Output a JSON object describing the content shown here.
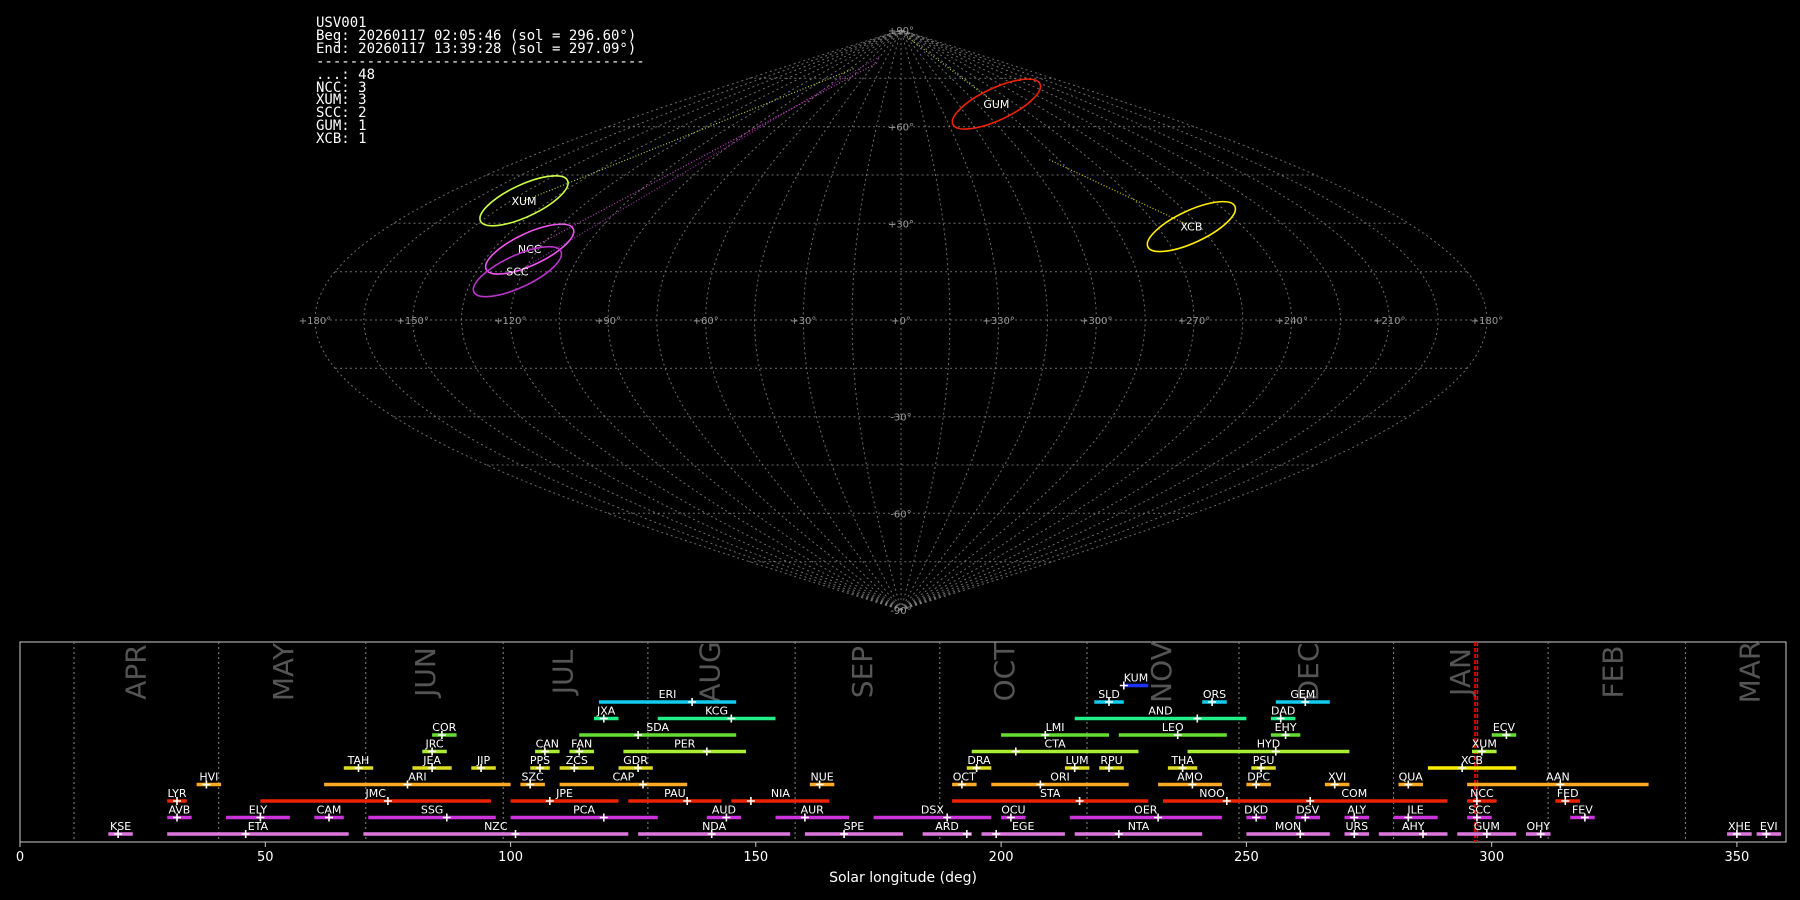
{
  "info": {
    "title": "USV001",
    "beg": "Beg: 20260117 02:05:46 (sol = 296.60°)",
    "end": "End: 20260117 13:39:28 (sol = 297.09°)",
    "divider": "---------------------------------------",
    "counts": [
      {
        "label": "...: 48"
      },
      {
        "label": "NCC: 3"
      },
      {
        "label": "XUM: 3"
      },
      {
        "label": "SCC: 2"
      },
      {
        "label": "GUM: 1"
      },
      {
        "label": "XCB: 1"
      }
    ]
  },
  "sky_map": {
    "type": "scatter",
    "projection": "sinusoidal",
    "lon_ticks": [
      "+180°",
      "+150°",
      "+120°",
      "+90°",
      "+60°",
      "+30°",
      "+0°",
      "+330°",
      "+300°",
      "+270°",
      "+240°",
      "+210°",
      "+180°"
    ],
    "lat_ticks": [
      {
        "lat": 90,
        "label": "+90°"
      },
      {
        "lat": 60,
        "label": "+60°"
      },
      {
        "lat": 30,
        "label": "+30°"
      },
      {
        "lat": -30,
        "label": "-30°"
      },
      {
        "lat": -60,
        "label": "-60°"
      },
      {
        "lat": -90,
        "label": "-90°"
      }
    ],
    "radiants": [
      {
        "name": "XUM",
        "lon": 145,
        "lat": 37,
        "color": "#ccff44"
      },
      {
        "name": "NCC",
        "lon": 123,
        "lat": 22,
        "color": "#ee55ee"
      },
      {
        "name": "SCC",
        "lon": 122,
        "lat": 15,
        "color": "#bb33cc"
      },
      {
        "name": "GUM",
        "lon": 285,
        "lat": 67,
        "color": "#ee2200"
      },
      {
        "name": "XCB",
        "lon": 258,
        "lat": 29,
        "color": "#ffee00"
      }
    ]
  },
  "timeline": {
    "type": "bar",
    "xlabel": "Solar longitude (deg)",
    "xlim": [
      0,
      360
    ],
    "xticks": [
      0,
      50,
      100,
      150,
      200,
      250,
      300,
      350
    ],
    "current_sol": [
      296.6,
      297.09
    ],
    "months": [
      {
        "name": "APR",
        "start": 11,
        "center": 24
      },
      {
        "name": "MAY",
        "start": 40.5,
        "center": 54
      },
      {
        "name": "JUN",
        "start": 70.5,
        "center": 83
      },
      {
        "name": "JUL",
        "start": 98.5,
        "center": 111
      },
      {
        "name": "AUG",
        "start": 128,
        "center": 141
      },
      {
        "name": "SEP",
        "start": 158,
        "center": 172
      },
      {
        "name": "OCT",
        "start": 187.5,
        "center": 201
      },
      {
        "name": "NOV",
        "start": 217.5,
        "center": 233
      },
      {
        "name": "DEC",
        "start": 248.5,
        "center": 263
      },
      {
        "name": "JAN",
        "start": 280,
        "center": 294
      },
      {
        "name": "FEB",
        "start": 311.5,
        "center": 325
      },
      {
        "name": "MAR",
        "start": 339.5,
        "center": 353
      }
    ],
    "showers": [
      {
        "name": "KUM",
        "row": 9,
        "start": 225,
        "end": 230,
        "peak": 225,
        "color": "#1a33ff"
      },
      {
        "name": "ERI",
        "row": 8,
        "start": 118,
        "end": 146,
        "peak": 137,
        "color": "#11ccee"
      },
      {
        "name": "SLD",
        "row": 8,
        "start": 219,
        "end": 225,
        "peak": 222,
        "color": "#11ccee"
      },
      {
        "name": "ORS",
        "row": 8,
        "start": 241,
        "end": 246,
        "peak": 243,
        "color": "#11ccee"
      },
      {
        "name": "GEM",
        "row": 8,
        "start": 256,
        "end": 267,
        "peak": 262,
        "color": "#11ccee"
      },
      {
        "name": "JXA",
        "row": 7,
        "start": 117,
        "end": 122,
        "peak": 119,
        "color": "#22ee88"
      },
      {
        "name": "KCG",
        "row": 7,
        "start": 130,
        "end": 154,
        "peak": 145,
        "color": "#22ee88"
      },
      {
        "name": "AND",
        "row": 7,
        "start": 215,
        "end": 250,
        "peak": 240,
        "color": "#22ee88"
      },
      {
        "name": "DAD",
        "row": 7,
        "start": 255,
        "end": 260,
        "peak": 257,
        "color": "#22ee88"
      },
      {
        "name": "COR",
        "row": 6,
        "start": 84,
        "end": 89,
        "peak": 86,
        "color": "#66dd33"
      },
      {
        "name": "SDA",
        "row": 6,
        "start": 114,
        "end": 146,
        "peak": 126,
        "color": "#66dd33"
      },
      {
        "name": "LMI",
        "row": 6,
        "start": 200,
        "end": 222,
        "peak": 209,
        "color": "#66dd33"
      },
      {
        "name": "LEO",
        "row": 6,
        "start": 224,
        "end": 246,
        "peak": 236,
        "color": "#66dd33"
      },
      {
        "name": "EHY",
        "row": 6,
        "start": 255,
        "end": 261,
        "peak": 258,
        "color": "#66dd33"
      },
      {
        "name": "ECV",
        "row": 6,
        "start": 300,
        "end": 305,
        "peak": 303,
        "color": "#66dd33"
      },
      {
        "name": "JRC",
        "row": 5,
        "start": 82,
        "end": 87,
        "peak": 84,
        "color": "#aaee33"
      },
      {
        "name": "CAN",
        "row": 5,
        "start": 105,
        "end": 110,
        "peak": 107,
        "color": "#aaee33"
      },
      {
        "name": "FAN",
        "row": 5,
        "start": 112,
        "end": 117,
        "peak": 114,
        "color": "#aaee33"
      },
      {
        "name": "PER",
        "row": 5,
        "start": 123,
        "end": 148,
        "peak": 140,
        "color": "#aaee33"
      },
      {
        "name": "CTA",
        "row": 5,
        "start": 194,
        "end": 228,
        "peak": 203,
        "color": "#aaee33"
      },
      {
        "name": "HYD",
        "row": 5,
        "start": 238,
        "end": 271,
        "peak": 256,
        "color": "#aaee33"
      },
      {
        "name": "XUM",
        "row": 5,
        "start": 296,
        "end": 301,
        "peak": 298,
        "color": "#aaee33"
      },
      {
        "name": "TAH",
        "row": 4,
        "start": 66,
        "end": 72,
        "peak": 69,
        "color": "#dddd22"
      },
      {
        "name": "JEA",
        "row": 4,
        "start": 80,
        "end": 88,
        "peak": 84,
        "color": "#dddd22"
      },
      {
        "name": "JIP",
        "row": 4,
        "start": 92,
        "end": 97,
        "peak": 94,
        "color": "#dddd22"
      },
      {
        "name": "PPS",
        "row": 4,
        "start": 104,
        "end": 108,
        "peak": 106,
        "color": "#dddd22"
      },
      {
        "name": "ZCS",
        "row": 4,
        "start": 110,
        "end": 117,
        "peak": 113,
        "color": "#dddd22"
      },
      {
        "name": "GDR",
        "row": 4,
        "start": 122,
        "end": 129,
        "peak": 126,
        "color": "#dddd22"
      },
      {
        "name": "DRA",
        "row": 4,
        "start": 193,
        "end": 198,
        "peak": 195,
        "color": "#dddd22"
      },
      {
        "name": "LUM",
        "row": 4,
        "start": 213,
        "end": 218,
        "peak": 215,
        "color": "#dddd22"
      },
      {
        "name": "RPU",
        "row": 4,
        "start": 220,
        "end": 225,
        "peak": 222,
        "color": "#dddd22"
      },
      {
        "name": "THA",
        "row": 4,
        "start": 234,
        "end": 240,
        "peak": 237,
        "color": "#dddd22"
      },
      {
        "name": "PSU",
        "row": 4,
        "start": 251,
        "end": 256,
        "peak": 253,
        "color": "#dddd22"
      },
      {
        "name": "XCB",
        "row": 4,
        "start": 287,
        "end": 305,
        "peak": 294,
        "color": "#ffee00"
      },
      {
        "name": "HVI",
        "row": 3,
        "start": 36,
        "end": 41,
        "peak": 38,
        "color": "#ffaa22"
      },
      {
        "name": "ARI",
        "row": 3,
        "start": 62,
        "end": 100,
        "peak": 79,
        "color": "#ffaa22"
      },
      {
        "name": "SZC",
        "row": 3,
        "start": 102,
        "end": 107,
        "peak": 104,
        "color": "#ffaa22"
      },
      {
        "name": "CAP",
        "row": 3,
        "start": 110,
        "end": 136,
        "peak": 127,
        "color": "#ffaa22"
      },
      {
        "name": "NUE",
        "row": 3,
        "start": 161,
        "end": 166,
        "peak": 163,
        "color": "#ffaa22"
      },
      {
        "name": "OCT",
        "row": 3,
        "start": 190,
        "end": 195,
        "peak": 192,
        "color": "#ffaa22"
      },
      {
        "name": "ORI",
        "row": 3,
        "start": 198,
        "end": 226,
        "peak": 208,
        "color": "#ffaa22"
      },
      {
        "name": "AMO",
        "row": 3,
        "start": 232,
        "end": 245,
        "peak": 239,
        "color": "#ffaa22"
      },
      {
        "name": "DPC",
        "row": 3,
        "start": 250,
        "end": 255,
        "peak": 252,
        "color": "#ffaa22"
      },
      {
        "name": "XVI",
        "row": 3,
        "start": 266,
        "end": 271,
        "peak": 268,
        "color": "#ffaa22"
      },
      {
        "name": "QUA",
        "row": 3,
        "start": 281,
        "end": 286,
        "peak": 283,
        "color": "#ffaa22"
      },
      {
        "name": "AAN",
        "row": 3,
        "start": 295,
        "end": 332,
        "peak": 314,
        "color": "#ffaa22"
      },
      {
        "name": "LYR",
        "row": 2,
        "start": 30,
        "end": 34,
        "peak": 32,
        "color": "#ee2200"
      },
      {
        "name": "JMC",
        "row": 2,
        "start": 49,
        "end": 96,
        "peak": 75,
        "color": "#ee2200"
      },
      {
        "name": "JPE",
        "row": 2,
        "start": 100,
        "end": 122,
        "peak": 108,
        "color": "#ee2200"
      },
      {
        "name": "PAU",
        "row": 2,
        "start": 124,
        "end": 143,
        "peak": 136,
        "color": "#ee2200"
      },
      {
        "name": "NIA",
        "row": 2,
        "start": 145,
        "end": 165,
        "peak": 149,
        "color": "#ee2200"
      },
      {
        "name": "STA",
        "row": 2,
        "start": 190,
        "end": 230,
        "peak": 216,
        "color": "#ee2200"
      },
      {
        "name": "NOO",
        "row": 2,
        "start": 233,
        "end": 253,
        "peak": 246,
        "color": "#ee2200"
      },
      {
        "name": "COM",
        "row": 2,
        "start": 253,
        "end": 291,
        "peak": 263,
        "color": "#ee2200"
      },
      {
        "name": "NCC",
        "row": 2,
        "start": 295,
        "end": 301,
        "peak": 297,
        "color": "#ee2200"
      },
      {
        "name": "FED",
        "row": 2,
        "start": 313,
        "end": 318,
        "peak": 315,
        "color": "#ee2200"
      },
      {
        "name": "AVB",
        "row": 1,
        "start": 30,
        "end": 35,
        "peak": 32,
        "color": "#cc33dd"
      },
      {
        "name": "ELY",
        "row": 1,
        "start": 42,
        "end": 55,
        "peak": 49,
        "color": "#cc33dd"
      },
      {
        "name": "CAM",
        "row": 1,
        "start": 60,
        "end": 66,
        "peak": 63,
        "color": "#cc33dd"
      },
      {
        "name": "SSG",
        "row": 1,
        "start": 71,
        "end": 97,
        "peak": 87,
        "color": "#cc33dd"
      },
      {
        "name": "PCA",
        "row": 1,
        "start": 100,
        "end": 130,
        "peak": 119,
        "color": "#cc33dd"
      },
      {
        "name": "AUD",
        "row": 1,
        "start": 140,
        "end": 147,
        "peak": 144,
        "color": "#cc33dd"
      },
      {
        "name": "AUR",
        "row": 1,
        "start": 154,
        "end": 169,
        "peak": 160,
        "color": "#cc33dd"
      },
      {
        "name": "DSX",
        "row": 1,
        "start": 174,
        "end": 198,
        "peak": 189,
        "color": "#cc33dd"
      },
      {
        "name": "OCU",
        "row": 1,
        "start": 200,
        "end": 205,
        "peak": 202,
        "color": "#cc33dd"
      },
      {
        "name": "OER",
        "row": 1,
        "start": 214,
        "end": 245,
        "peak": 232,
        "color": "#cc33dd"
      },
      {
        "name": "DKD",
        "row": 1,
        "start": 250,
        "end": 254,
        "peak": 252,
        "color": "#cc33dd"
      },
      {
        "name": "DSV",
        "row": 1,
        "start": 260,
        "end": 265,
        "peak": 262,
        "color": "#cc33dd"
      },
      {
        "name": "ALY",
        "row": 1,
        "start": 270,
        "end": 275,
        "peak": 272,
        "color": "#cc33dd"
      },
      {
        "name": "ILE",
        "row": 1,
        "start": 280,
        "end": 289,
        "peak": 283,
        "color": "#cc33dd"
      },
      {
        "name": "SCC",
        "row": 1,
        "start": 295,
        "end": 300,
        "peak": 297,
        "color": "#cc33dd"
      },
      {
        "name": "FEV",
        "row": 1,
        "start": 316,
        "end": 321,
        "peak": 319,
        "color": "#cc33dd"
      },
      {
        "name": "KSE",
        "row": 0,
        "start": 18,
        "end": 23,
        "peak": 20,
        "color": "#dd77dd"
      },
      {
        "name": "ETA",
        "row": 0,
        "start": 30,
        "end": 67,
        "peak": 46,
        "color": "#dd77dd"
      },
      {
        "name": "NZC",
        "row": 0,
        "start": 70,
        "end": 124,
        "peak": 101,
        "color": "#dd77dd"
      },
      {
        "name": "NDA",
        "row": 0,
        "start": 126,
        "end": 157,
        "peak": 141,
        "color": "#dd77dd"
      },
      {
        "name": "SPE",
        "row": 0,
        "start": 160,
        "end": 180,
        "peak": 168,
        "color": "#dd77dd"
      },
      {
        "name": "ARD",
        "row": 0,
        "start": 184,
        "end": 194,
        "peak": 193,
        "color": "#dd77dd"
      },
      {
        "name": "EGE",
        "row": 0,
        "start": 196,
        "end": 213,
        "peak": 199,
        "color": "#dd77dd"
      },
      {
        "name": "NTA",
        "row": 0,
        "start": 215,
        "end": 241,
        "peak": 224,
        "color": "#dd77dd"
      },
      {
        "name": "MON",
        "row": 0,
        "start": 250,
        "end": 267,
        "peak": 261,
        "color": "#dd77dd"
      },
      {
        "name": "URS",
        "row": 0,
        "start": 270,
        "end": 275,
        "peak": 272,
        "color": "#dd77dd"
      },
      {
        "name": "AHY",
        "row": 0,
        "start": 277,
        "end": 291,
        "peak": 286,
        "color": "#dd77dd"
      },
      {
        "name": "GUM",
        "row": 0,
        "start": 293,
        "end": 305,
        "peak": 299,
        "color": "#dd77dd"
      },
      {
        "name": "OHY",
        "row": 0,
        "start": 307,
        "end": 312,
        "peak": 310,
        "color": "#dd77dd"
      },
      {
        "name": "XHE",
        "row": 0,
        "start": 348,
        "end": 353,
        "peak": 350,
        "color": "#dd77dd"
      },
      {
        "name": "EVI",
        "row": 0,
        "start": 354,
        "end": 359,
        "peak": 356,
        "color": "#dd77dd"
      }
    ]
  },
  "colors": {
    "background": "#000000",
    "grid": "#888888",
    "axis_text": "#ffffff",
    "month_label": "#555555",
    "current_sol": "#ff0000"
  }
}
